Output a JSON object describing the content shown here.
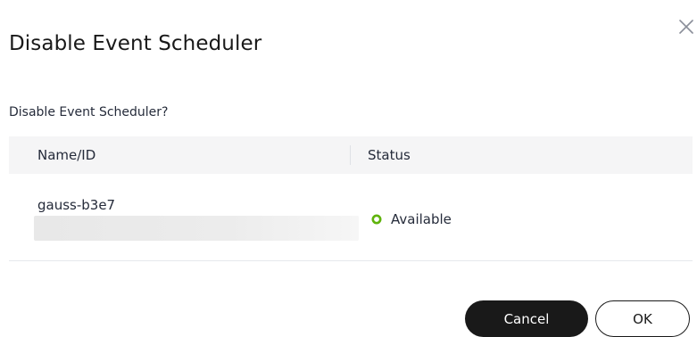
{
  "dialog": {
    "title": "Disable Event Scheduler",
    "prompt": "Disable Event Scheduler?",
    "close_icon": "close-icon"
  },
  "table": {
    "columns": [
      "Name/ID",
      "Status"
    ],
    "rows": [
      {
        "name": "gauss-b3e7",
        "status": "Available",
        "status_icon": "status-available-icon",
        "status_color": "#5fb30c"
      }
    ]
  },
  "buttons": {
    "cancel_label": "Cancel",
    "ok_label": "OK"
  }
}
